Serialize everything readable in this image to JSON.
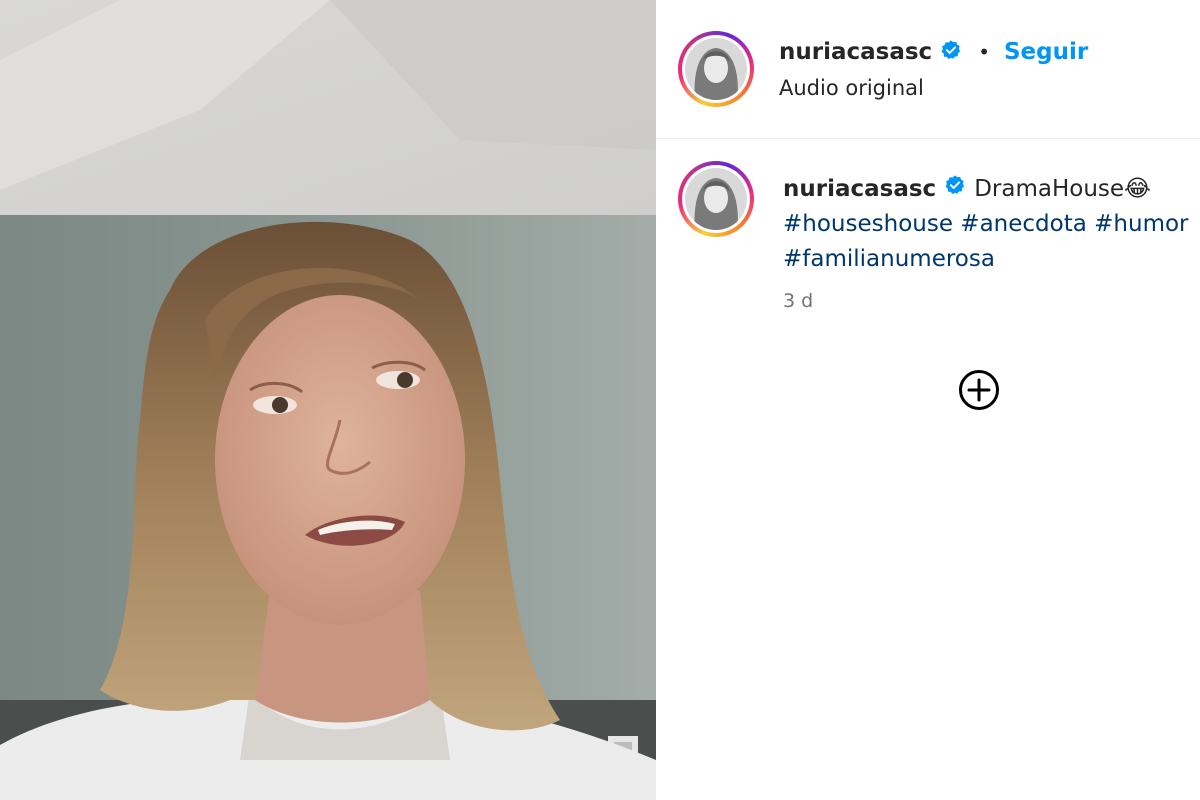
{
  "post": {
    "username": "nuriacasasc",
    "follow_label": "Seguir",
    "separator": "•",
    "audio": "Audio original"
  },
  "caption": {
    "username": "nuriacasasc",
    "text": "DramaHouse",
    "emoji": "😂",
    "hashtags": [
      "#houseshouse",
      "#anecdota",
      "#humor",
      "#familianumerosa"
    ],
    "time": "3 d"
  },
  "icons": {
    "verified": "verified-badge-icon",
    "more": "plus-circle-icon"
  },
  "colors": {
    "link_blue": "#0095f6",
    "hashtag": "#00376b",
    "verified_blue": "#0095f6"
  }
}
